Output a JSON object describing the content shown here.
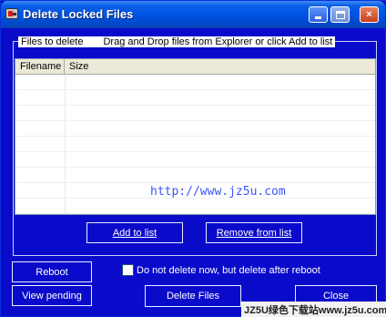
{
  "window": {
    "title": "Delete Locked Files",
    "controls": {
      "minimize": "minimize",
      "maximize": "maximize",
      "close": "×"
    }
  },
  "group": {
    "label": "Files to delete",
    "hint": "Drag and Drop files from Explorer or click Add to list"
  },
  "list": {
    "columns": [
      "Filename",
      "Size"
    ],
    "rows": []
  },
  "buttons": {
    "add_to_list": "Add to list",
    "remove_from_list": "Remove from list",
    "reboot": "Reboot",
    "view_pending": "View pending",
    "delete_files": "Delete Files",
    "close": "Close"
  },
  "options": {
    "delete_after_reboot_label": "Do not delete now, but delete after reboot",
    "delete_after_reboot_checked": false
  },
  "watermarks": {
    "url": "http://www.jz5u.com",
    "footer": "JZ5U绿色下载站www.jz5u.com"
  },
  "colors": {
    "client_bg": "#0a0acb",
    "titlebar": "#0054e3",
    "button_text": "#ffffff"
  }
}
